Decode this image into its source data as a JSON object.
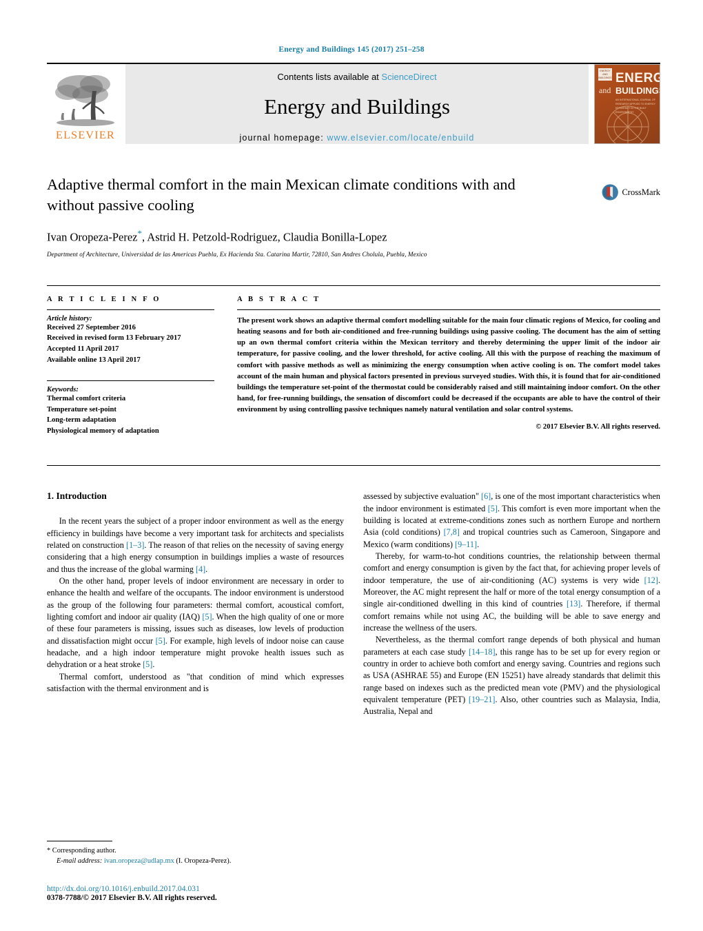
{
  "running_head": "Energy and Buildings 145 (2017) 251–258",
  "masthead": {
    "contents_prefix": "Contents lists available at ",
    "contents_link": "ScienceDirect",
    "journal_title": "Energy and Buildings",
    "homepage_prefix": "journal homepage: ",
    "homepage_url": "www.elsevier.com/locate/enbuild",
    "publisher_wordmark": "ELSEVIER",
    "cover": {
      "badge_text": "ENERGY AND BUILDINGS",
      "energy": "ENERGY",
      "and": "and",
      "buildings": "BUILDINGS",
      "subtitle": "AN INTERNATIONAL JOURNAL OF RESEARCH APPLIED TO ENERGY EFFICIENCY IN THE BUILT ENVIRONMENT"
    },
    "colors": {
      "accent_blue": "#3e9cc6",
      "elsevier_orange": "#ef7d20",
      "band_gray": "#e9e9e9"
    }
  },
  "article": {
    "title": "Adaptive thermal comfort in the main Mexican climate conditions with and without passive cooling",
    "authors": "Ivan Oropeza-Perez, Astrid H. Petzold-Rodriguez, Claudia Bonilla-Lopez",
    "author_first": "Ivan Oropeza-Perez",
    "corresponding_mark": "*",
    "authors_rest": ", Astrid H. Petzold-Rodriguez, Claudia Bonilla-Lopez",
    "affiliation": "Department of Architecture, Universidad de las Americas Puebla, Ex Hacienda Sta. Catarina Martir, 72810, San Andres Cholula, Puebla, Mexico",
    "crossmark_label": "CrossMark"
  },
  "article_info": {
    "heading": "A R T I C L E   I N F O",
    "history_label": "Article history:",
    "history": [
      "Received 27 September 2016",
      "Received in revised form 13 February 2017",
      "Accepted 11 April 2017",
      "Available online 13 April 2017"
    ],
    "keywords_label": "Keywords:",
    "keywords": [
      "Thermal comfort criteria",
      "Temperature set-point",
      "Long-term adaptation",
      "Physiological memory of adaptation"
    ]
  },
  "abstract": {
    "heading": "A B S T R A C T",
    "text": "The present work shows an adaptive thermal comfort modelling suitable for the main four climatic regions of Mexico, for cooling and heating seasons and for both air-conditioned and free-running buildings using passive cooling. The document has the aim of setting up an own thermal comfort criteria within the Mexican territory and thereby determining the upper limit of the indoor air temperature, for passive cooling, and the lower threshold, for active cooling. All this with the purpose of reaching the maximum of comfort with passive methods as well as minimizing the energy consumption when active cooling is on. The comfort model takes account of the main human and physical factors presented in previous surveyed studies. With this, it is found that for air-conditioned buildings the temperature set-point of the thermostat could be considerably raised and still maintaining indoor comfort. On the other hand, for free-running buildings, the sensation of discomfort could be decreased if the occupants are able to have the control of their environment by using controlling passive techniques namely natural ventilation and solar control systems.",
    "copyright": "© 2017 Elsevier B.V. All rights reserved."
  },
  "introduction": {
    "heading": "1. Introduction",
    "left_paragraphs": [
      "In the recent years the subject of a proper indoor environment as well as the energy efficiency in buildings have become a very important task for architects and specialists related on construction [1–3]. The reason of that relies on the necessity of saving energy considering that a high energy consumption in buildings implies a waste of resources and thus the increase of the global warming [4].",
      "On the other hand, proper levels of indoor environment are necessary in order to enhance the health and welfare of the occupants. The indoor environment is understood as the group of the following four parameters: thermal comfort, acoustical comfort, lighting comfort and indoor air quality (IAQ) [5]. When the high quality of one or more of these four parameters is missing, issues such as diseases, low levels of production and dissatisfaction might occur [5]. For example, high levels of indoor noise can cause headache, and a high indoor temperature might provoke health issues such as dehydration or a heat stroke [5].",
      "Thermal comfort, understood as \"that condition of mind which expresses satisfaction with the thermal environment and is"
    ],
    "right_paragraphs": [
      "assessed by subjective evaluation\" [6], is one of the most important characteristics when the indoor environment is estimated [5]. This comfort is even more important when the building is located at extreme-conditions zones such as northern Europe and northern Asia (cold conditions) [7,8] and tropical countries such as Cameroon, Singapore and Mexico (warm conditions) [9–11].",
      "Thereby, for warm-to-hot conditions countries, the relationship between thermal comfort and energy consumption is given by the fact that, for achieving proper levels of indoor temperature, the use of air-conditioning (AC) systems is very wide [12]. Moreover, the AC might represent the half or more of the total energy consumption of a single air-conditioned dwelling in this kind of countries [13]. Therefore, if thermal comfort remains while not using AC, the building will be able to save energy and increase the wellness of the users.",
      "Nevertheless, as the thermal comfort range depends of both physical and human parameters at each case study [14–18], this range has to be set up for every region or country in order to achieve both comfort and energy saving. Countries and regions such as USA (ASHRAE 55) and Europe (EN 15251) have already standards that delimit this range based on indexes such as the predicted mean vote (PMV) and the physiological equivalent temperature (PET) [19–21]. Also, other countries such as Malaysia, India, Australia, Nepal and"
    ]
  },
  "footer": {
    "corresponding_author": "* Corresponding author.",
    "email_label": "E-mail address:",
    "email": "ivan.oropeza@udlap.mx",
    "email_suffix": "(I. Oropeza-Perez).",
    "doi": "http://dx.doi.org/10.1016/j.enbuild.2017.04.031",
    "issn_line": "0378-7788/© 2017 Elsevier B.V. All rights reserved."
  }
}
